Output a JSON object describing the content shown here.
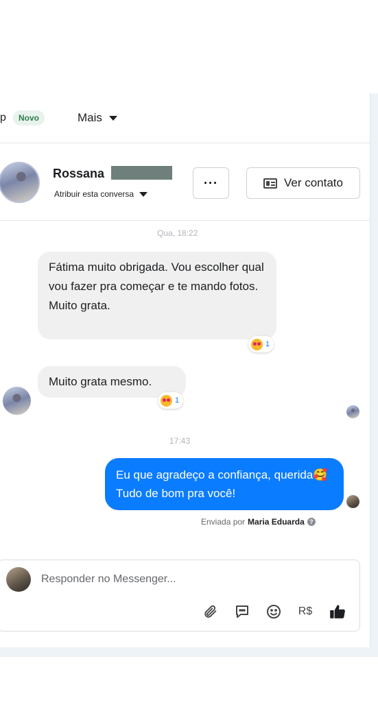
{
  "tabs": {
    "partial_label": "p",
    "novo_badge": "Novo",
    "more_label": "Mais"
  },
  "header": {
    "contact_name": "Rossana",
    "assign_label": "Atribuir esta conversa",
    "more_button": "···",
    "view_contact_label": "Ver contato"
  },
  "messages": {
    "timestamp_1": "Qua, 18:22",
    "incoming_1": "Fátima muito obrigada. Vou escolher qual vou fazer pra começar e te mando fotos. Muito grata.",
    "reaction_1_count": "1",
    "incoming_2": "Muito grata mesmo.",
    "reaction_2_count": "1",
    "timestamp_2": "17:43",
    "outgoing_1": "Eu que agradeço a confiança, querida🥰Tudo de bom pra você!",
    "sent_by_prefix": "Enviada por",
    "sent_by_name": "Maria Eduarda"
  },
  "composer": {
    "placeholder": "Responder no Messenger...",
    "currency_label": "R$"
  },
  "icons": {
    "attach": "paperclip-icon",
    "chat": "chat-bubble-icon",
    "emoji": "smiley-icon",
    "like": "thumbs-up-icon",
    "contact": "contact-card-icon"
  },
  "colors": {
    "outgoing_bubble": "#0a7cff",
    "incoming_bubble": "#f0f0f0",
    "badge_bg": "#e7f3ec",
    "badge_text": "#2e7d4f"
  }
}
